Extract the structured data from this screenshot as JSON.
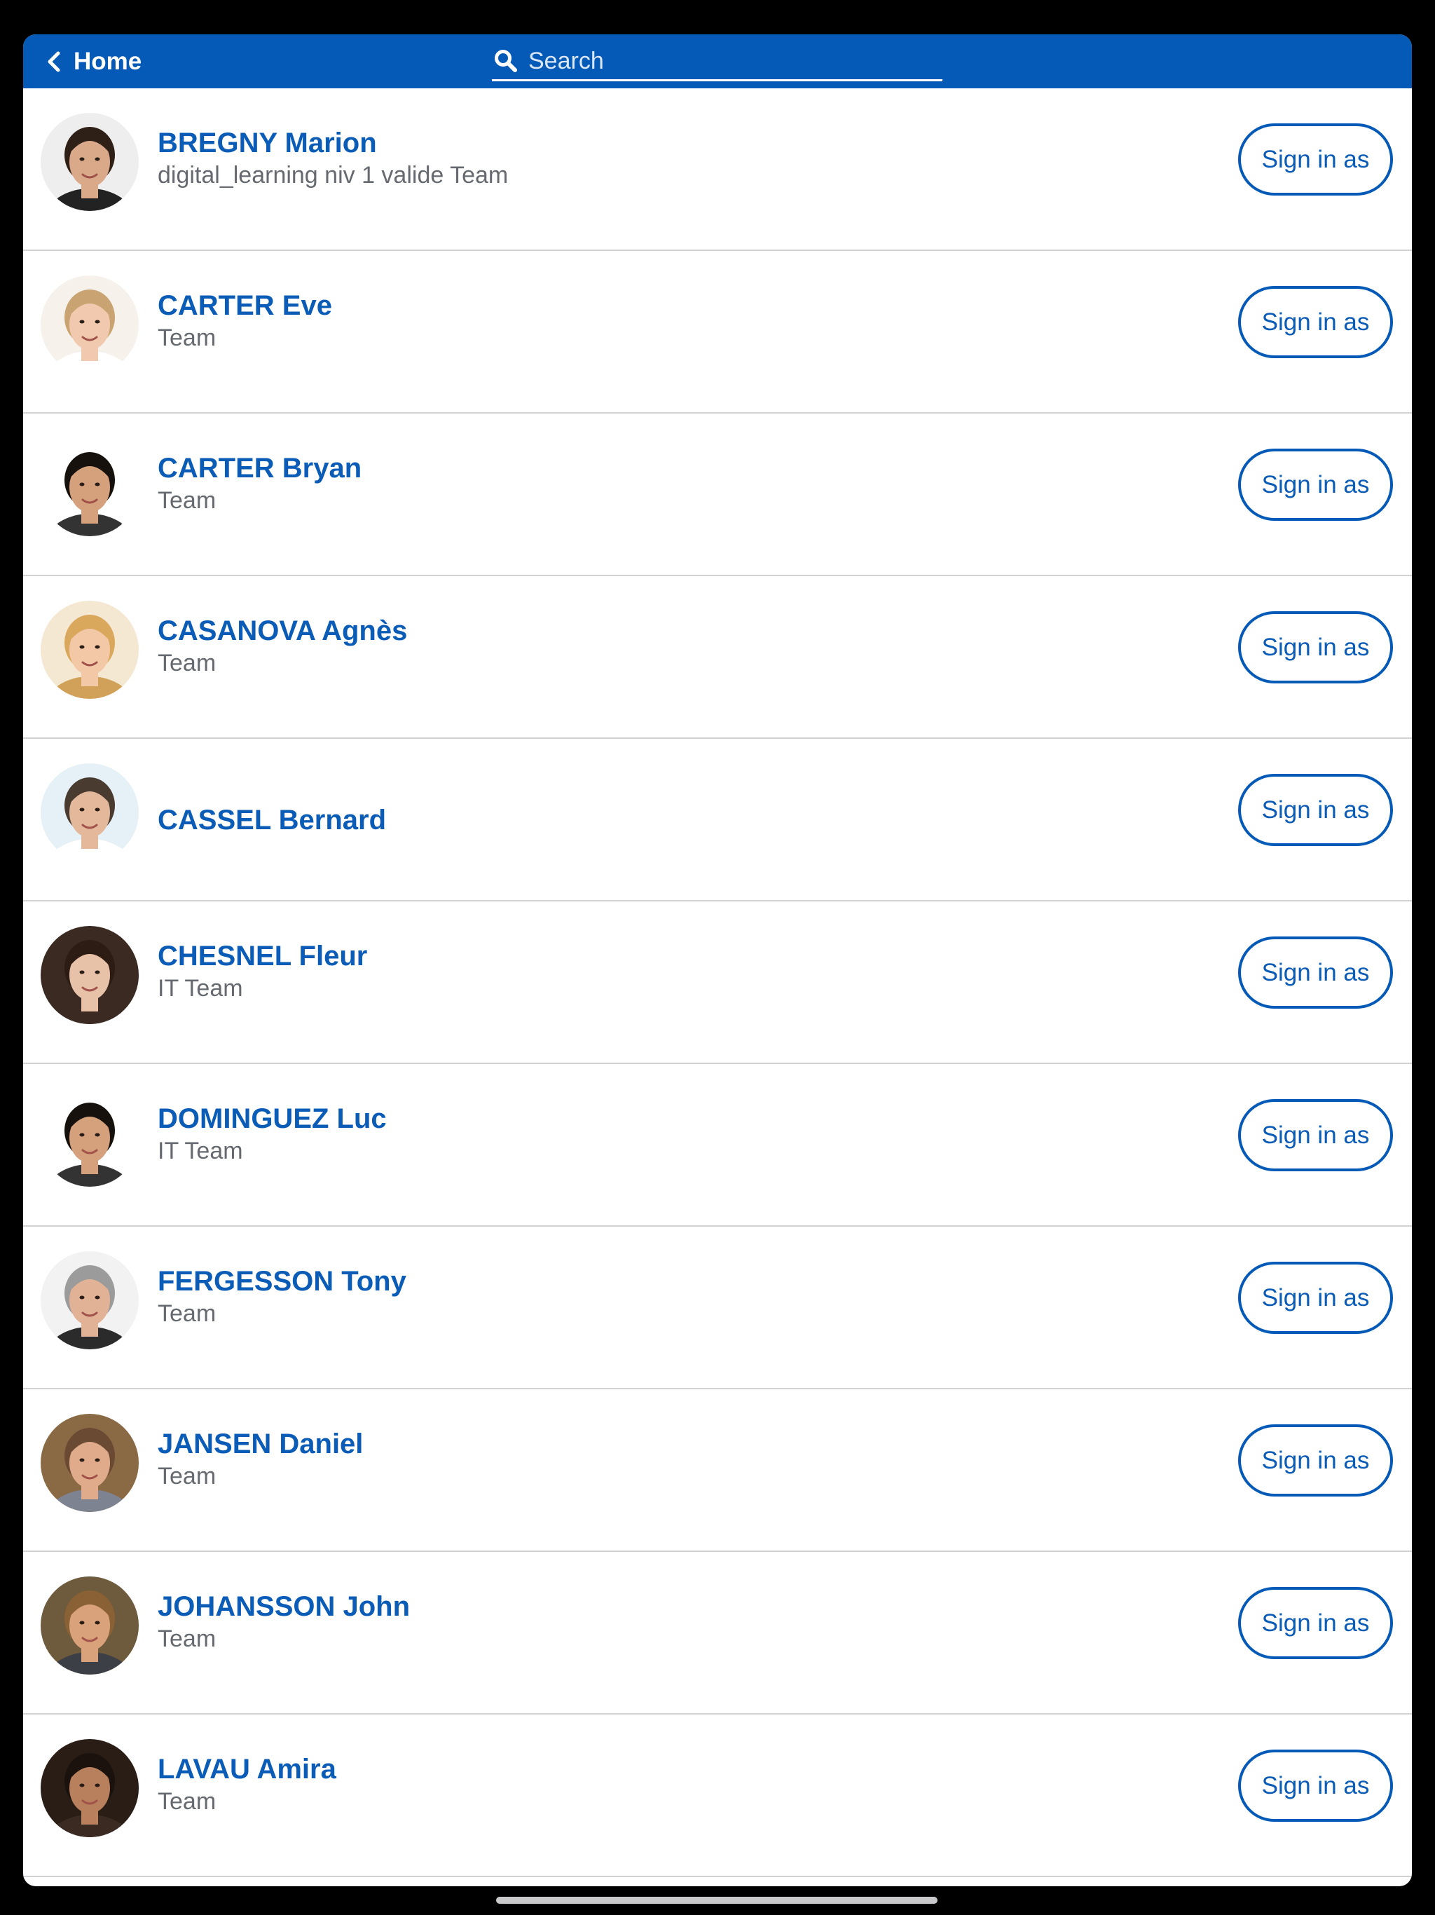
{
  "navbar": {
    "back_label": "Home",
    "back_icon": "chevron-left-icon",
    "search_placeholder": "Search",
    "search_value": "",
    "search_icon": "search-icon",
    "background_color": "#055ab7"
  },
  "users": [
    {
      "name": "BREGNY Marion",
      "team": "digital_learning niv 1 valide Team",
      "action": "Sign in as",
      "avatar": {
        "skin": "#d9a98a",
        "hair": "#2e1f17",
        "bg": "#eeeeee",
        "shirt": "#222222"
      }
    },
    {
      "name": "CARTER Eve",
      "team": "Team",
      "action": "Sign in as",
      "avatar": {
        "skin": "#f0c9ae",
        "hair": "#c9a472",
        "bg": "#f6f1ea",
        "shirt": "#ffffff"
      }
    },
    {
      "name": "CARTER Bryan",
      "team": "Team",
      "action": "Sign in as",
      "avatar": {
        "skin": "#d5a07c",
        "hair": "#17110d",
        "bg": "#ffffff",
        "shirt": "#333333"
      }
    },
    {
      "name": "CASANOVA Agnès",
      "team": "Team",
      "action": "Sign in as",
      "avatar": {
        "skin": "#f2c8a6",
        "hair": "#d9a85c",
        "bg": "#f5e8d3",
        "shirt": "#d1a15a"
      }
    },
    {
      "name": "CASSEL Bernard",
      "team": "",
      "action": "Sign in as",
      "avatar": {
        "skin": "#e4b89a",
        "hair": "#4a3b30",
        "bg": "#e6f0f7",
        "shirt": "#ffffff"
      }
    },
    {
      "name": "CHESNEL Fleur",
      "team": "IT Team",
      "action": "Sign in as",
      "avatar": {
        "skin": "#e7c1a8",
        "hair": "#2d1c14",
        "bg": "#3a2a22",
        "shirt": "#3b2a22"
      }
    },
    {
      "name": "DOMINGUEZ Luc",
      "team": "IT Team",
      "action": "Sign in as",
      "avatar": {
        "skin": "#d5a07c",
        "hair": "#17110d",
        "bg": "#ffffff",
        "shirt": "#333333"
      }
    },
    {
      "name": "FERGESSON Tony",
      "team": "Team",
      "action": "Sign in as",
      "avatar": {
        "skin": "#e2b296",
        "hair": "#9b9b9b",
        "bg": "#f2f2f2",
        "shirt": "#2b2b2b"
      }
    },
    {
      "name": "JANSEN Daniel",
      "team": "Team",
      "action": "Sign in as",
      "avatar": {
        "skin": "#e0ab8b",
        "hair": "#6b4a33",
        "bg": "#8a6a45",
        "shirt": "#7d8390"
      }
    },
    {
      "name": "JOHANSSON John",
      "team": "Team",
      "action": "Sign in as",
      "avatar": {
        "skin": "#d9a27a",
        "hair": "#8a6134",
        "bg": "#6e5a3c",
        "shirt": "#3c3f46"
      }
    },
    {
      "name": "LAVAU Amira",
      "team": "Team",
      "action": "Sign in as",
      "avatar": {
        "skin": "#b9805e",
        "hair": "#1b120d",
        "bg": "#2a1d16",
        "shirt": "#3a2a22"
      }
    }
  ],
  "colors": {
    "accent": "#0b5cb6",
    "secondary_text": "#666a70",
    "divider": "#d2d2d6"
  }
}
